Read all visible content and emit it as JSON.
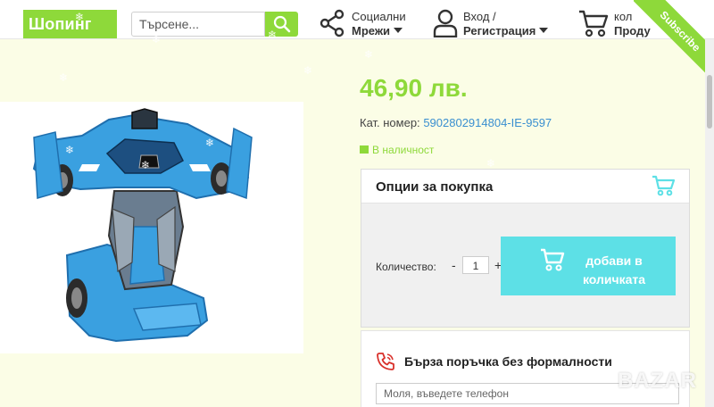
{
  "header": {
    "logo_text": "Шопинг",
    "search_placeholder": "Търсене...",
    "social": {
      "line1": "Социални",
      "line2": "Мрежи"
    },
    "account": {
      "line1": "Вход /",
      "line2": "Регистрация"
    },
    "cart": {
      "line1": "кол",
      "line2": "Проду"
    },
    "subscribe_label": "Subscribe"
  },
  "product": {
    "price": "46,90 лв.",
    "catalog_label": "Кат. номер:",
    "catalog_number": "5902802914804-IE-9597",
    "stock": "В наличност"
  },
  "purchase": {
    "title": "Опции за покупка",
    "qty_label": "Количество:",
    "qty_minus": "-",
    "qty_value": "1",
    "qty_plus": "+",
    "add_to_cart": "добави в количката"
  },
  "quick_order": {
    "title": "Бърза поръчка без формалности",
    "phone_placeholder": "Моля, въведете телефон"
  },
  "watermark": "BAZAR",
  "colors": {
    "accent_green": "#8ed93a",
    "cyan_button": "#5de0e6",
    "link_blue": "#3a8fd0",
    "page_bg": "#fbfde6",
    "phone_icon_red": "#d9312b"
  },
  "icons": [
    "search-icon",
    "share-icon",
    "user-icon",
    "cart-icon",
    "gift-icon",
    "phone-icon"
  ]
}
